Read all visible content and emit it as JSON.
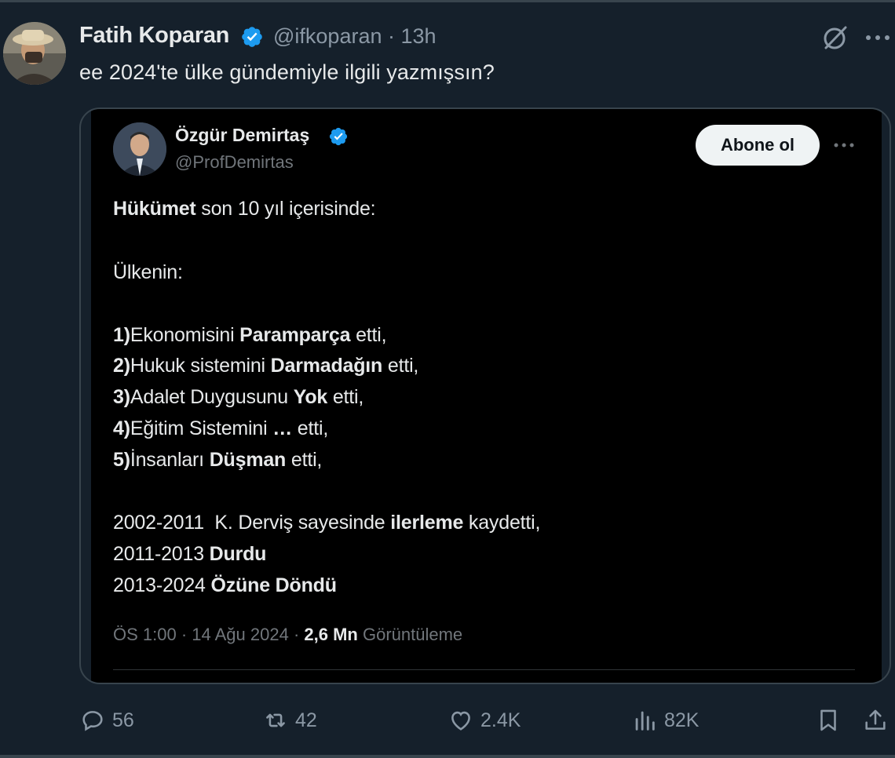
{
  "tweet": {
    "author_name": "Fatih Koparan",
    "handle_time": "@ifkoparan · 13h",
    "text": "ee 2024'te ülke gündemiyle ilgili yazmışsın?"
  },
  "quoted": {
    "author_name": "Özgür Demirtaş",
    "handle": "@ProfDemirtas",
    "follow_label": "Abone ol",
    "lines": [
      {
        "segments": [
          {
            "t": "Hükümet",
            "b": true
          },
          {
            "t": " son 10 yıl içerisinde:",
            "b": false
          }
        ]
      },
      {
        "segments": [
          {
            "t": "Ülkenin:",
            "b": false
          }
        ]
      },
      {
        "segments": [
          {
            "t": "1)",
            "b": true
          },
          {
            "t": "Ekonomisini ",
            "b": false
          },
          {
            "t": "Paramparça",
            "b": true
          },
          {
            "t": " etti,",
            "b": false
          }
        ]
      },
      {
        "segments": [
          {
            "t": "2)",
            "b": true
          },
          {
            "t": "Hukuk sistemini ",
            "b": false
          },
          {
            "t": "Darmadağın",
            "b": true
          },
          {
            "t": " etti,",
            "b": false
          }
        ]
      },
      {
        "segments": [
          {
            "t": "3)",
            "b": true
          },
          {
            "t": "Adalet Duygusunu ",
            "b": false
          },
          {
            "t": "Yok",
            "b": true
          },
          {
            "t": " etti,",
            "b": false
          }
        ]
      },
      {
        "segments": [
          {
            "t": "4)",
            "b": true
          },
          {
            "t": "Eğitim Sistemini ",
            "b": false
          },
          {
            "t": "…",
            "b": true
          },
          {
            "t": " etti,",
            "b": false
          }
        ]
      },
      {
        "segments": [
          {
            "t": "5)",
            "b": true
          },
          {
            "t": "İnsanları ",
            "b": false
          },
          {
            "t": "Düşman",
            "b": true
          },
          {
            "t": " etti,",
            "b": false
          }
        ]
      },
      {
        "segments": [
          {
            "t": "2002-2011  K. Derviş sayesinde ",
            "b": false
          },
          {
            "t": "ilerleme",
            "b": true
          },
          {
            "t": " kaydetti,",
            "b": false
          }
        ]
      },
      {
        "segments": [
          {
            "t": "2011-2013 ",
            "b": false
          },
          {
            "t": "Durdu",
            "b": true
          }
        ]
      },
      {
        "segments": [
          {
            "t": "2013-2024 ",
            "b": false
          },
          {
            "t": "Özüne Döndü",
            "b": true
          }
        ]
      }
    ],
    "meta_time": "ÖS 1:00 · 14 Ağu 2024 · ",
    "meta_views": "2,6 Mn",
    "meta_views_label": " Görüntüleme"
  },
  "actions": {
    "replies": "56",
    "reposts": "42",
    "likes": "2.4K",
    "views": "82K"
  },
  "icons": {
    "verified": "verified-badge-icon",
    "grok": "grok-icon",
    "more": "more-icon",
    "reply": "reply-icon",
    "repost": "repost-icon",
    "like": "like-icon",
    "views": "views-icon",
    "bookmark": "bookmark-icon",
    "share": "share-icon"
  },
  "colors": {
    "background": "#15202b",
    "accent": "#1d9bf0",
    "muted": "#8b98a5"
  }
}
